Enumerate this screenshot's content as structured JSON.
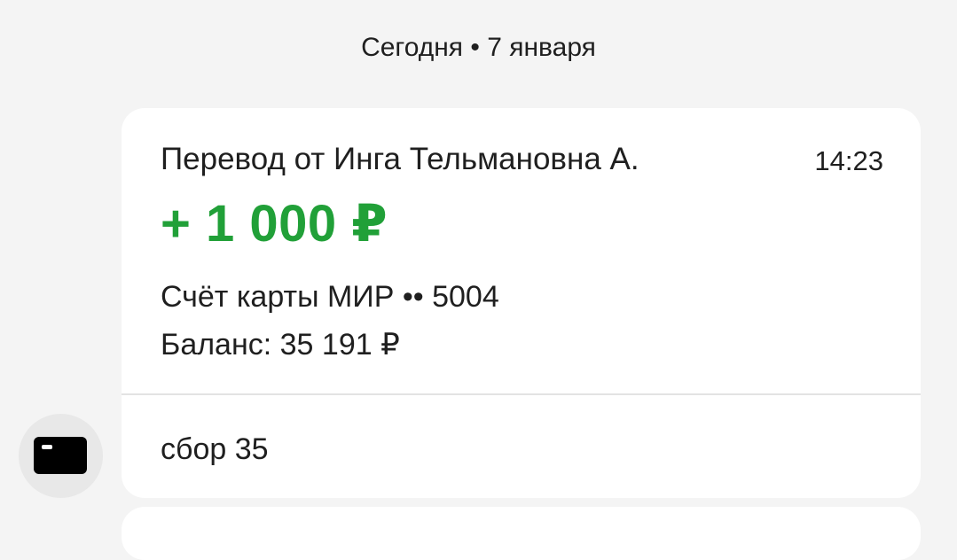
{
  "date_header": "Сегодня • 7 января",
  "message": {
    "title": "Перевод от Инга Тельмановна А.",
    "time": "14:23",
    "amount": "+ 1 000 ₽",
    "account": "Счёт карты МИР •• 5004",
    "balance": "Баланс: 35 191 ₽",
    "comment": "сбор 35"
  },
  "icons": {
    "avatar": "card-icon"
  },
  "colors": {
    "background": "#f4f4f4",
    "card": "#ffffff",
    "amount_green": "#21a038",
    "text": "#1f1f1f"
  }
}
